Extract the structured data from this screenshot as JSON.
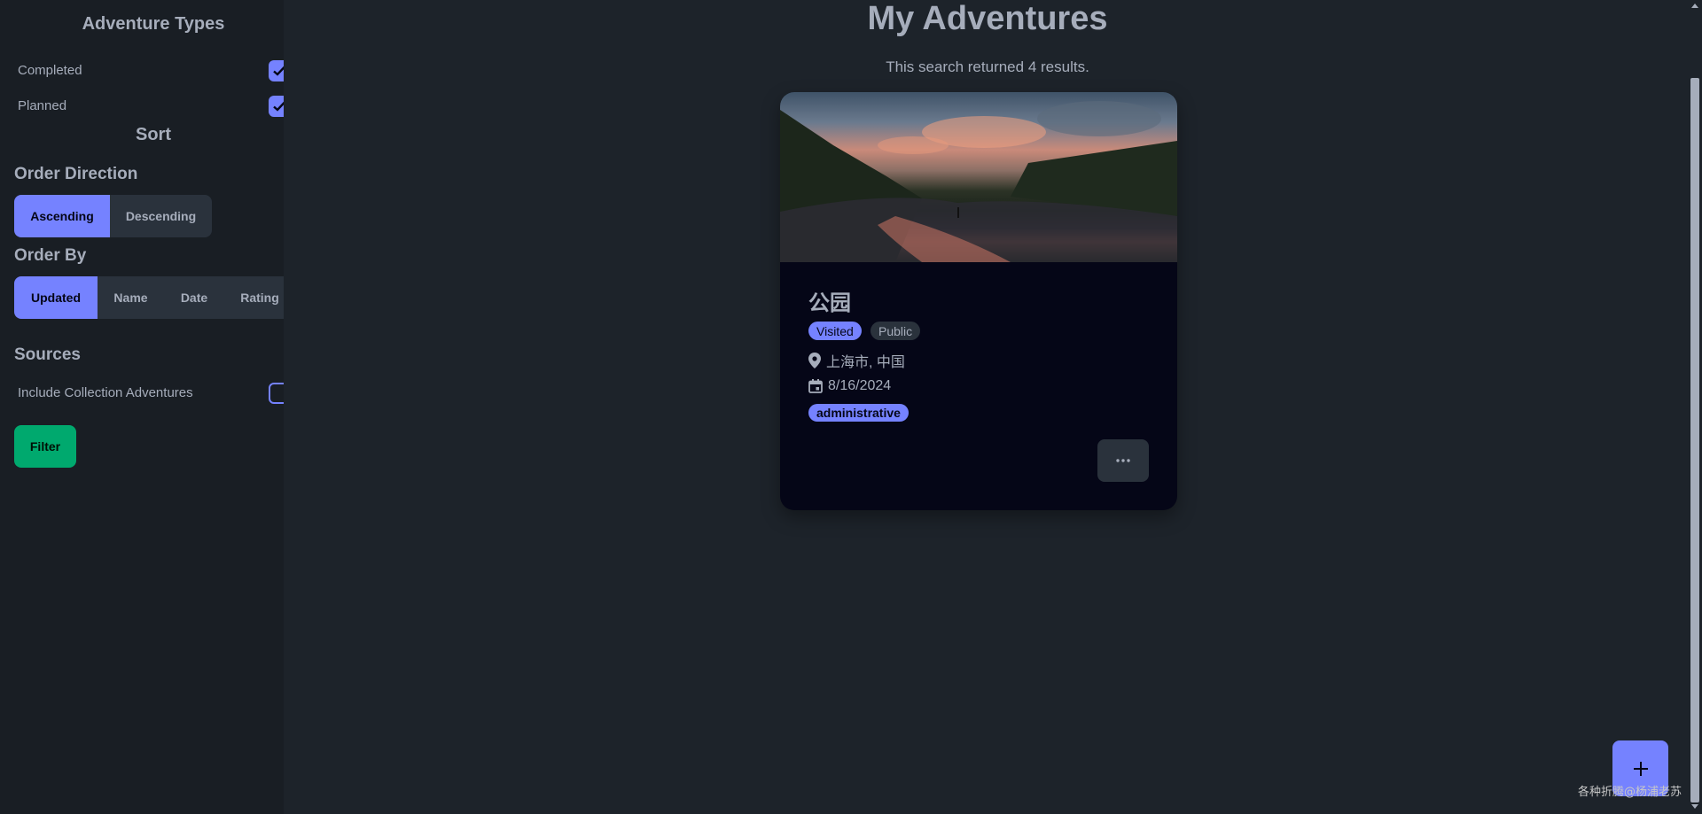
{
  "sidebar": {
    "adventure_types_title": "Adventure Types",
    "types": [
      {
        "label": "Completed",
        "checked": true
      },
      {
        "label": "Planned",
        "checked": true
      }
    ],
    "sort_title": "Sort",
    "order_direction": {
      "heading": "Order Direction",
      "options": [
        "Ascending",
        "Descending"
      ],
      "selected": "Ascending"
    },
    "order_by": {
      "heading": "Order By",
      "options": [
        "Updated",
        "Name",
        "Date",
        "Rating"
      ],
      "selected": "Updated"
    },
    "sources": {
      "heading": "Sources",
      "include_collection_label": "Include Collection Adventures",
      "include_collection_checked": false
    },
    "filter_label": "Filter"
  },
  "main": {
    "title": "My Adventures",
    "result_text": "This search returned 4 results.",
    "card": {
      "name": "公园",
      "badge_visited": "Visited",
      "badge_public": "Public",
      "location": "上海市, 中国",
      "date": "8/16/2024",
      "tag": "administrative",
      "more_icon": "ellipsis-icon"
    }
  },
  "fab_icon": "plus-icon",
  "watermark": "各种折腾@杨浦老苏",
  "colors": {
    "background": "#1d232a",
    "sidebar": "#191e24",
    "primary": "#7582ff",
    "success": "#00a96e",
    "neutral": "#2a323c",
    "card": "#050617",
    "text": "#a6adbb"
  }
}
